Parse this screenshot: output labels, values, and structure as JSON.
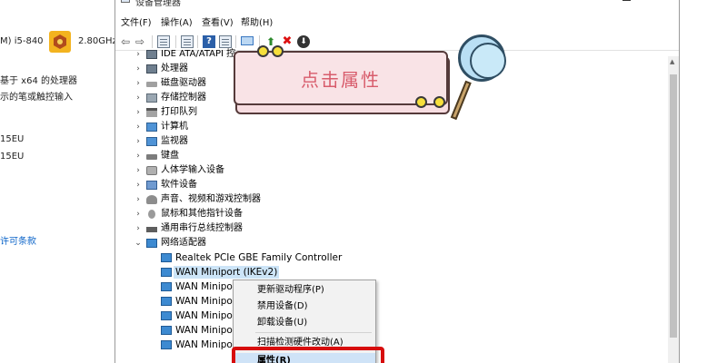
{
  "background_panel": {
    "cpu_prefix": "M) i5-840",
    "cpu_speed": "2.80GHz",
    "system_type": "基于 x64 的处理器",
    "pen_touch": "示的笔或触控输入",
    "edition_1": "15EU",
    "edition_2": "15EU",
    "license_link": "许可条款"
  },
  "window": {
    "title": "设备管理器",
    "min_glyph": "—",
    "close_glyph": "✕"
  },
  "menu": [
    "文件(F)",
    "操作(A)",
    "查看(V)",
    "帮助(H)"
  ],
  "toolbar": {
    "back": "⇦",
    "forward": "⇨",
    "help": "?",
    "update": "⬆",
    "uninstall": "✖",
    "download": "⬇"
  },
  "tree": {
    "categories": [
      {
        "label": "IDE ATA/ATAPI 控",
        "icon": "chip-icon"
      },
      {
        "label": "处理器",
        "icon": "processor-icon"
      },
      {
        "label": "磁盘驱动器",
        "icon": "disk-drive-icon"
      },
      {
        "label": "存储控制器",
        "icon": "storage-controller-icon"
      },
      {
        "label": "打印队列",
        "icon": "printer-icon"
      },
      {
        "label": "计算机",
        "icon": "computer-icon"
      },
      {
        "label": "监视器",
        "icon": "monitor-icon"
      },
      {
        "label": "键盘",
        "icon": "keyboard-icon"
      },
      {
        "label": "人体学输入设备",
        "icon": "hid-icon"
      },
      {
        "label": "软件设备",
        "icon": "software-device-icon"
      },
      {
        "label": "声音、视频和游戏控制器",
        "icon": "audio-icon"
      },
      {
        "label": "鼠标和其他指针设备",
        "icon": "mouse-icon"
      },
      {
        "label": "通用串行总线控制器",
        "icon": "usb-icon"
      },
      {
        "label": "网络适配器",
        "icon": "network-adapter-icon"
      }
    ],
    "network_children": [
      {
        "label": "Realtek PCIe GBE Family Controller"
      },
      {
        "label": "WAN Miniport (IKEv2)"
      },
      {
        "label": "WAN Minipor"
      },
      {
        "label": "WAN Minipor"
      },
      {
        "label": "WAN Minipor"
      },
      {
        "label": "WAN Minipor"
      },
      {
        "label": "WAN Minipor"
      }
    ],
    "expander_collapsed": "›",
    "expander_expanded": "⌄"
  },
  "context_menu": {
    "items": [
      {
        "label": "更新驱动程序(P)"
      },
      {
        "label": "禁用设备(D)"
      },
      {
        "label": "卸载设备(U)"
      },
      {
        "label": "扫描检测硬件改动(A)"
      },
      {
        "label": "属性(R)"
      }
    ]
  },
  "annotation": {
    "text": "点击属性"
  },
  "colors": {
    "highlight": "#d70d0d",
    "annotation_text": "#d85c6c",
    "annotation_bg": "#f7dde1",
    "selection": "#cce4f7"
  }
}
